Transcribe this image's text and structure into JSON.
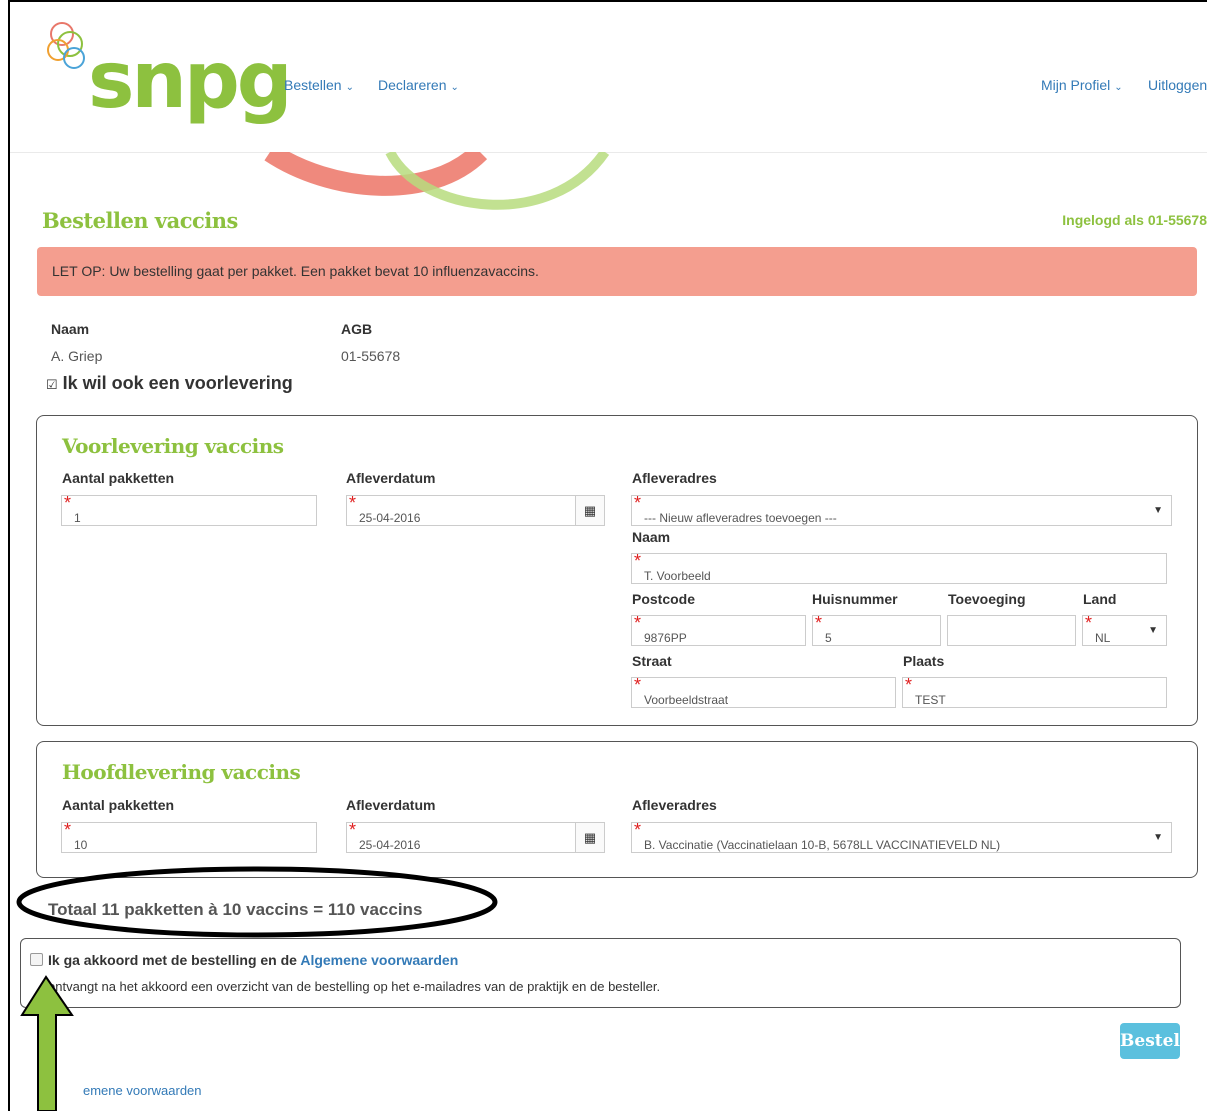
{
  "header": {
    "logo_text": "snpg",
    "nav_left": [
      "Bestellen",
      "Declareren"
    ],
    "nav_right": [
      "Mijn Profiel",
      "Uitloggen"
    ]
  },
  "page": {
    "title": "Bestellen vaccins",
    "logged_in": "Ingelogd als 01-55678",
    "alert": "LET OP: Uw bestelling gaat per pakket. Een pakket bevat 10 influenzavaccins."
  },
  "info": {
    "naam_label": "Naam",
    "naam_value": "A. Griep",
    "agb_label": "AGB",
    "agb_value": "01-55678",
    "voorlevering_check": "Ik wil ook een voorlevering"
  },
  "voorlevering": {
    "title": "Voorlevering vaccins",
    "aantal_label": "Aantal pakketten",
    "aantal_value": "1",
    "datum_label": "Afleverdatum",
    "datum_value": "25-04-2016",
    "adres_label": "Afleveradres",
    "adres_value": "--- Nieuw afleveradres toevoegen ---",
    "naam_label": "Naam",
    "naam_value": "T. Voorbeeld",
    "postcode_label": "Postcode",
    "postcode_value": "9876PP",
    "huisnummer_label": "Huisnummer",
    "huisnummer_value": "5",
    "toevoeging_label": "Toevoeging",
    "toevoeging_value": "",
    "land_label": "Land",
    "land_value": "NL",
    "straat_label": "Straat",
    "straat_value": "Voorbeeldstraat",
    "plaats_label": "Plaats",
    "plaats_value": "TEST"
  },
  "hoofdlevering": {
    "title": "Hoofdlevering vaccins",
    "aantal_label": "Aantal pakketten",
    "aantal_value": "10",
    "datum_label": "Afleverdatum",
    "datum_value": "25-04-2016",
    "adres_label": "Afleveradres",
    "adres_value": "B. Vaccinatie (Vaccinatielaan 10-B, 5678LL VACCINATIEVELD NL)"
  },
  "total": "Totaal 11 pakketten à 10 vaccins = 110 vaccins",
  "terms": {
    "agree_text": "Ik ga akkoord met de bestelling en de ",
    "agree_link": "Algemene voorwaarden",
    "note": "ontvangt na het akkoord een overzicht van de bestelling op het e-mailadres van de praktijk en de besteller."
  },
  "submit_label": "Bestel",
  "footer_link": "emene voorwaarden",
  "colors": {
    "brand_green": "#8dc13f",
    "alert_bg": "#f49e8f",
    "link_blue": "#337ab7",
    "button_blue": "#5bc0de"
  }
}
